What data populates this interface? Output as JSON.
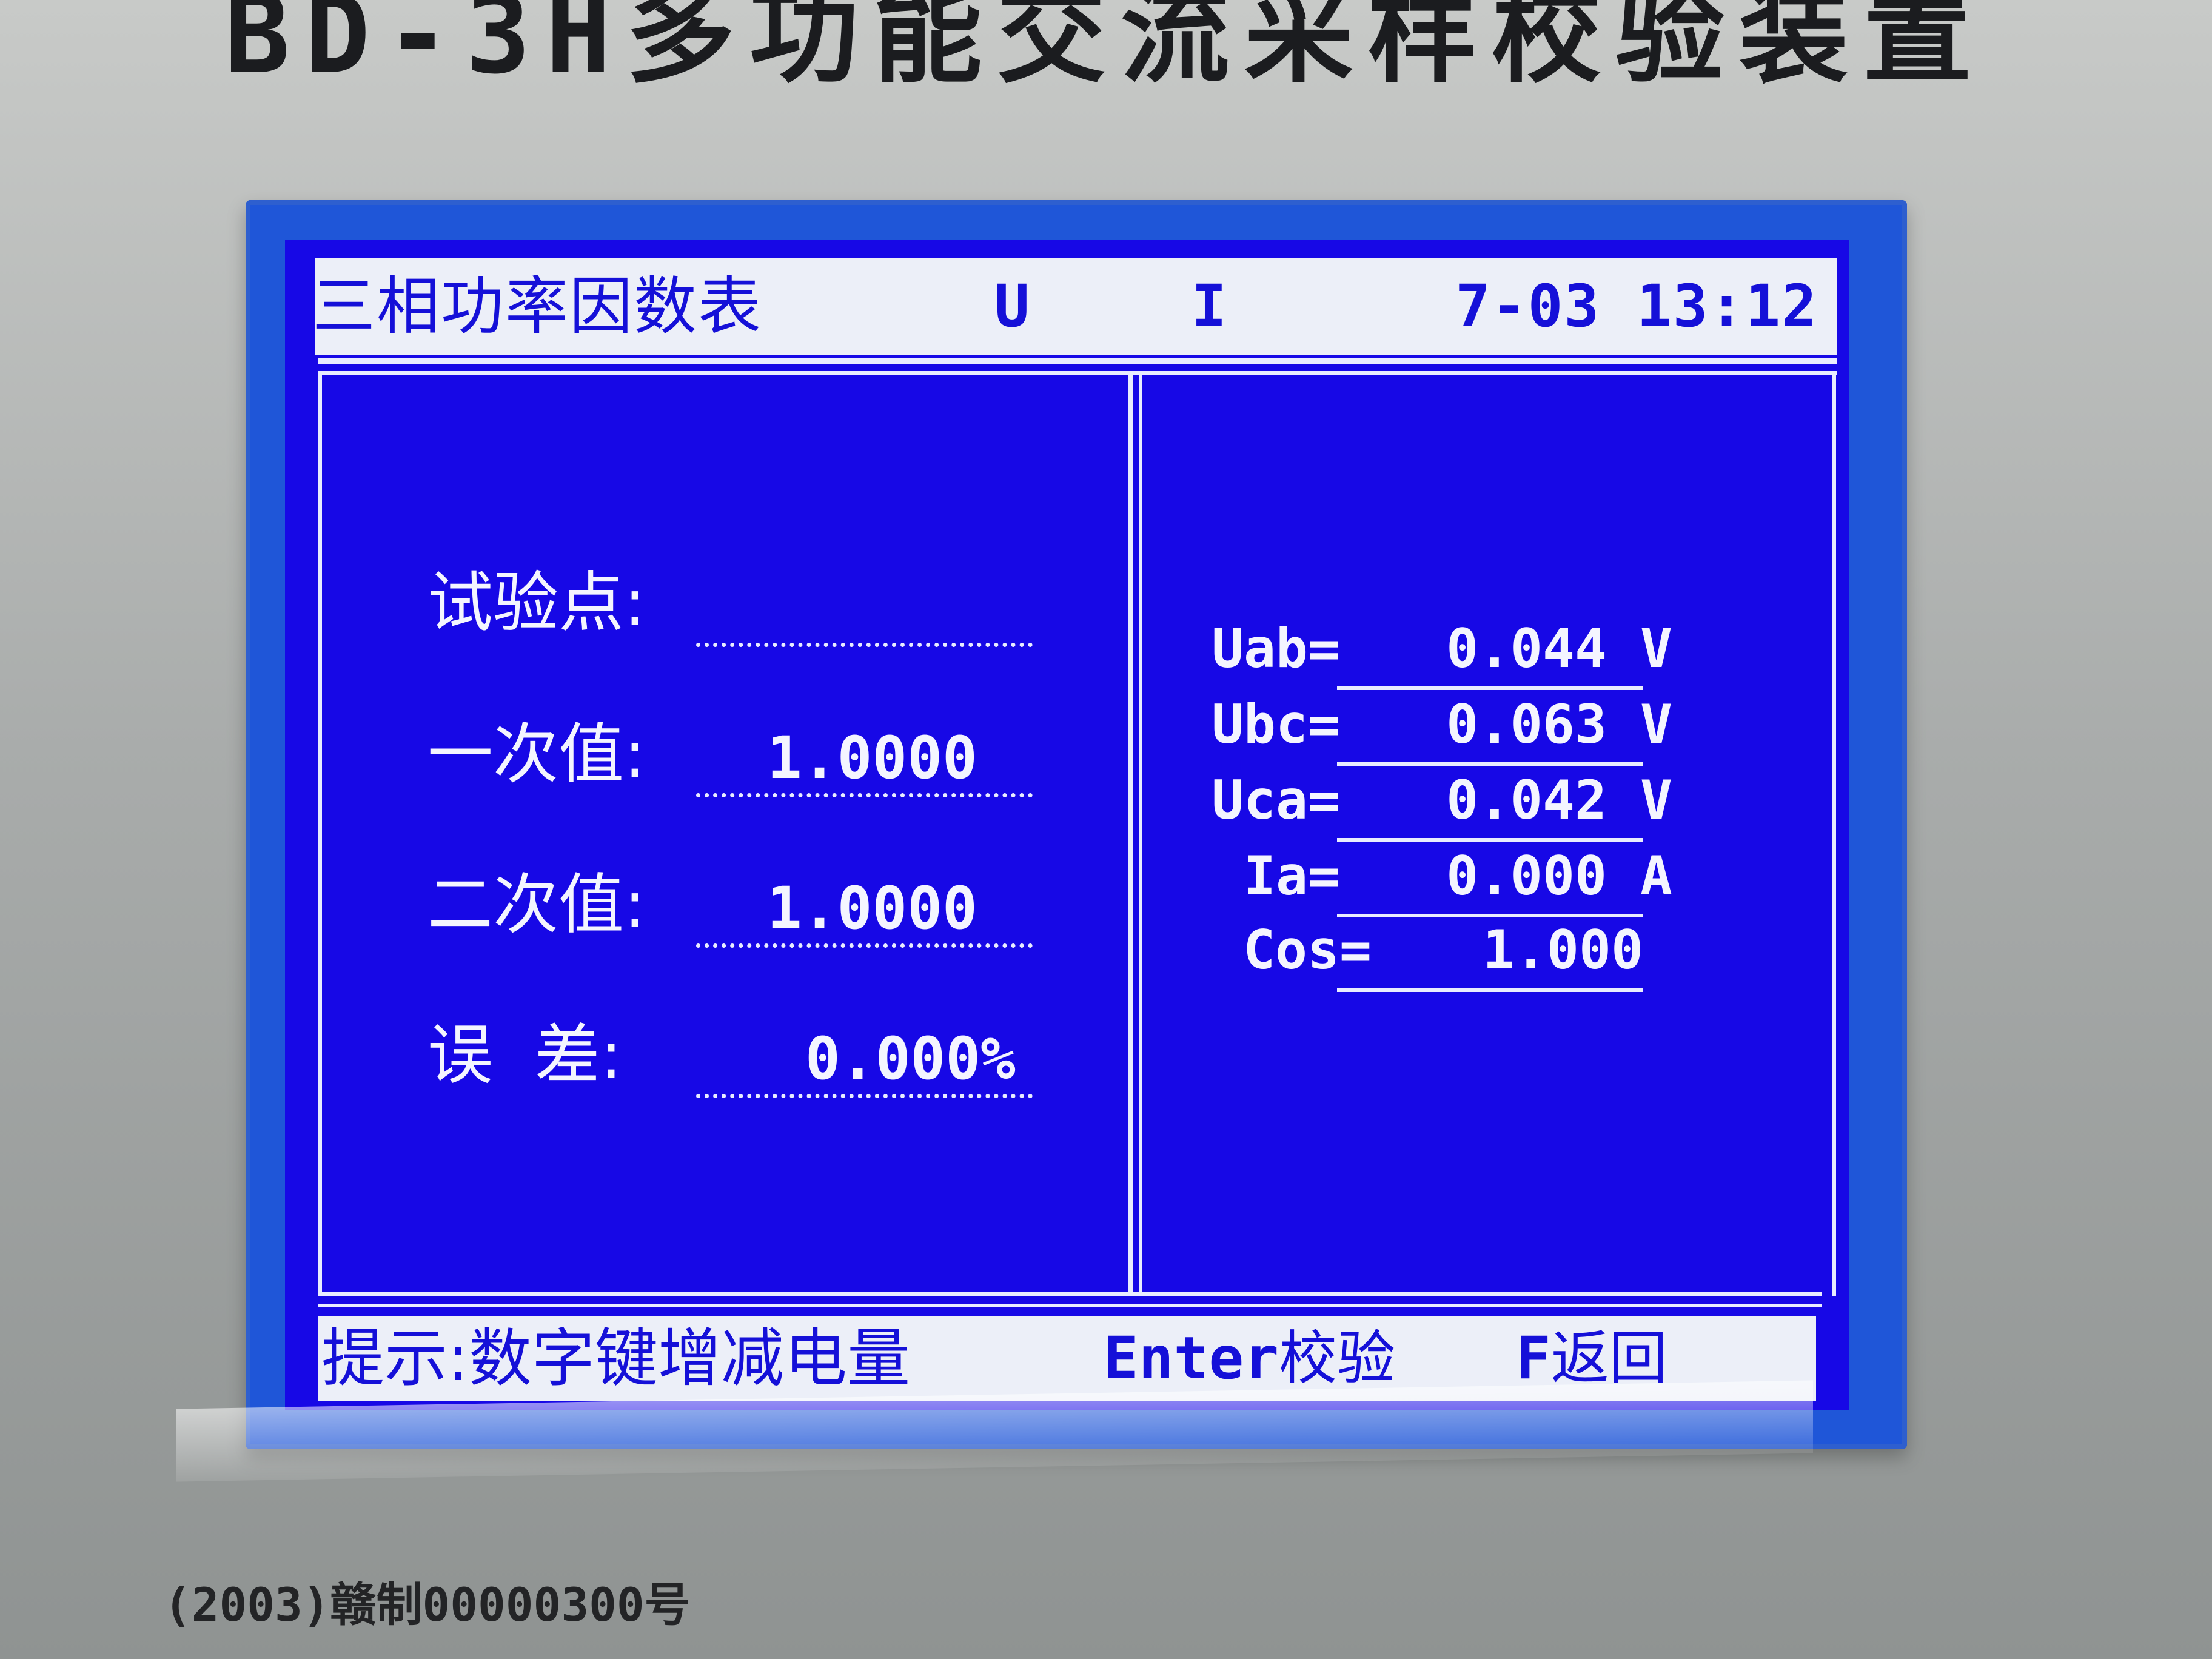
{
  "device": {
    "title": "BD-3H多功能交流采样校验装置",
    "certificate": "(2003)赣制00000300号"
  },
  "header": {
    "screen_title": "三相功率因数表",
    "indicator_u": "U",
    "indicator_i": "I",
    "datetime": "7-03 13:12"
  },
  "left_panel": {
    "test_point_label": "试验点:",
    "test_point_value": "",
    "primary_label": "一次值:",
    "primary_value": "1.0000",
    "secondary_label": "二次值:",
    "secondary_value": "1.0000",
    "error_label": "误  差:",
    "error_value": "0.000%"
  },
  "right_panel": {
    "readings": [
      {
        "label": "Uab=",
        "value": "0.044",
        "unit": "V"
      },
      {
        "label": "Ubc=",
        "value": "0.063",
        "unit": "V"
      },
      {
        "label": "Uca=",
        "value": "0.042",
        "unit": "V"
      },
      {
        "label": "Ia=",
        "value": "0.000",
        "unit": "A"
      },
      {
        "label": "Cos=",
        "value": "1.000",
        "unit": ""
      }
    ]
  },
  "footer": {
    "hint": "提示:数字键增减电量",
    "enter_key": "Enter",
    "enter_action": "校验",
    "back_key": "F",
    "back_action": "返回"
  },
  "colors": {
    "lcd_background": "#1708e6",
    "bezel": "#1f56d8",
    "bar_background": "#eceff8",
    "lcd_text": "#f4f5ff"
  }
}
